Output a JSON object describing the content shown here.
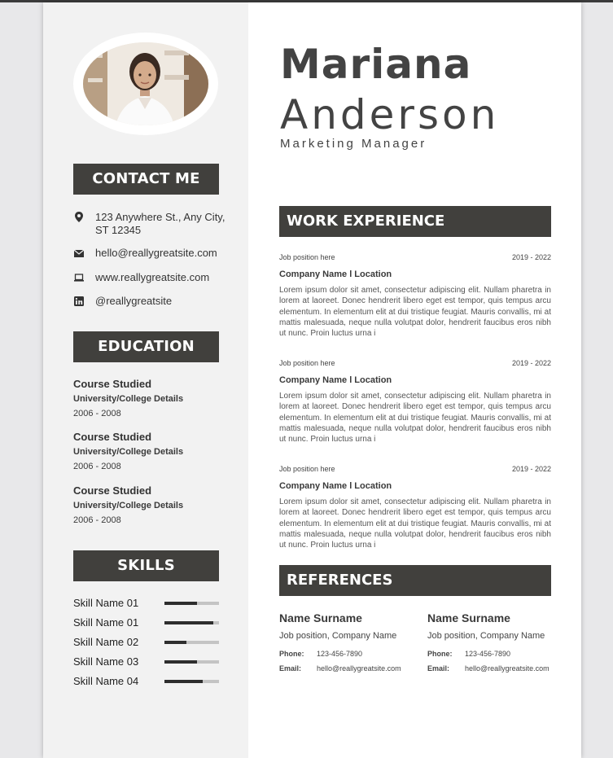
{
  "name": {
    "first": "Mariana",
    "last": "Anderson",
    "title": "Marketing Manager"
  },
  "contact": {
    "heading": "CONTACT ME",
    "items": [
      {
        "icon": "location-pin-icon",
        "text": "123 Anywhere St., Any City, ST 12345"
      },
      {
        "icon": "email-icon",
        "text": "hello@reallygreatsite.com"
      },
      {
        "icon": "laptop-icon",
        "text": "www.reallygreatsite.com"
      },
      {
        "icon": "linkedin-icon",
        "text": "@reallygreatsite"
      }
    ]
  },
  "education": {
    "heading": "EDUCATION",
    "items": [
      {
        "course": "Course Studied",
        "school": "University/College Details",
        "years": "2006 - 2008"
      },
      {
        "course": "Course Studied",
        "school": "University/College Details",
        "years": "2006 - 2008"
      },
      {
        "course": "Course Studied",
        "school": "University/College Details",
        "years": "2006 - 2008"
      }
    ]
  },
  "skills": {
    "heading": "SKILLS",
    "items": [
      {
        "name": "Skill Name 01",
        "level": 0.6
      },
      {
        "name": "Skill Name 01",
        "level": 0.9
      },
      {
        "name": "Skill Name 02",
        "level": 0.4
      },
      {
        "name": "Skill Name 03",
        "level": 0.6
      },
      {
        "name": "Skill Name 04",
        "level": 0.7
      }
    ]
  },
  "work": {
    "heading": "WORK EXPERIENCE",
    "jobs": [
      {
        "position": "Job position here",
        "years": "2019 - 2022",
        "company": "Company Name l Location",
        "description": "Lorem ipsum dolor sit amet, consectetur adipiscing elit. Nullam pharetra in lorem at laoreet. Donec hendrerit libero eget est tempor, quis tempus arcu elementum. In elementum elit at dui tristique feugiat. Mauris convallis, mi at mattis malesuada, neque nulla volutpat dolor, hendrerit faucibus eros nibh ut nunc. Proin luctus urna i"
      },
      {
        "position": "Job position here",
        "years": "2019 - 2022",
        "company": "Company Name l Location",
        "description": "Lorem ipsum dolor sit amet, consectetur adipiscing elit. Nullam pharetra in lorem at laoreet. Donec hendrerit libero eget est tempor, quis tempus arcu elementum. In elementum elit at dui tristique feugiat. Mauris convallis, mi at mattis malesuada, neque nulla volutpat dolor, hendrerit faucibus eros nibh ut nunc. Proin luctus urna i"
      },
      {
        "position": "Job position here",
        "years": "2019 - 2022",
        "company": "Company Name l Location",
        "description": "Lorem ipsum dolor sit amet, consectetur adipiscing elit. Nullam pharetra in lorem at laoreet. Donec hendrerit libero eget est tempor, quis tempus arcu elementum. In elementum elit at dui tristique feugiat. Mauris convallis, mi at mattis malesuada, neque nulla volutpat dolor, hendrerit faucibus eros nibh ut nunc. Proin luctus urna i"
      }
    ]
  },
  "references": {
    "heading": "REFERENCES",
    "items": [
      {
        "name": "Name Surname",
        "position": "Job position, Company Name",
        "phone_label": "Phone:",
        "phone": "123-456-7890",
        "email_label": "Email:",
        "email": "hello@reallygreatsite.com"
      },
      {
        "name": "Name Surname",
        "position": "Job position, Company Name",
        "phone_label": "Phone:",
        "phone": "123-456-7890",
        "email_label": "Email:",
        "email": "hello@reallygreatsite.com"
      }
    ]
  },
  "colors": {
    "heading_bg": "#41403d",
    "sidebar_bg": "#f2f2f2",
    "text_dark": "#434343"
  }
}
